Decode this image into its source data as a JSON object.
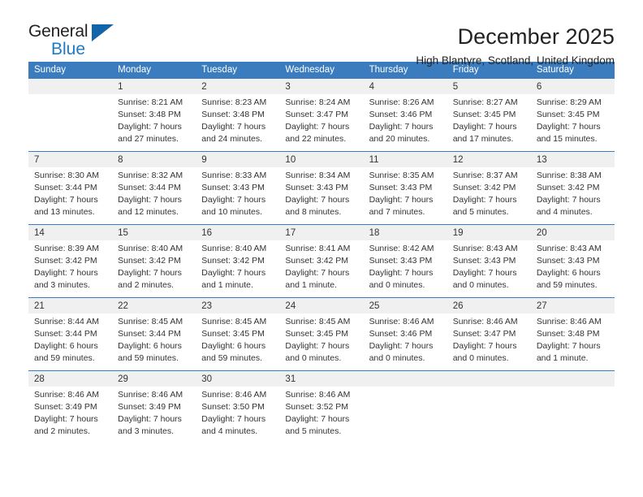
{
  "logo": {
    "primary_text": "General",
    "secondary_text": "Blue",
    "triangle_color": "#1165a8",
    "secondary_color": "#1f7ac4"
  },
  "header": {
    "title": "December 2025",
    "subtitle": "High Blantyre, Scotland, United Kingdom"
  },
  "colors": {
    "header_blue": "#3a7cbe",
    "daynum_bg": "#f0f0f0",
    "text": "#333333"
  },
  "weekdays": [
    "Sunday",
    "Monday",
    "Tuesday",
    "Wednesday",
    "Thursday",
    "Friday",
    "Saturday"
  ],
  "weeks": [
    [
      {
        "day": "",
        "sunrise": "",
        "sunset": "",
        "daylight": ""
      },
      {
        "day": "1",
        "sunrise": "Sunrise: 8:21 AM",
        "sunset": "Sunset: 3:48 PM",
        "daylight": "Daylight: 7 hours and 27 minutes."
      },
      {
        "day": "2",
        "sunrise": "Sunrise: 8:23 AM",
        "sunset": "Sunset: 3:48 PM",
        "daylight": "Daylight: 7 hours and 24 minutes."
      },
      {
        "day": "3",
        "sunrise": "Sunrise: 8:24 AM",
        "sunset": "Sunset: 3:47 PM",
        "daylight": "Daylight: 7 hours and 22 minutes."
      },
      {
        "day": "4",
        "sunrise": "Sunrise: 8:26 AM",
        "sunset": "Sunset: 3:46 PM",
        "daylight": "Daylight: 7 hours and 20 minutes."
      },
      {
        "day": "5",
        "sunrise": "Sunrise: 8:27 AM",
        "sunset": "Sunset: 3:45 PM",
        "daylight": "Daylight: 7 hours and 17 minutes."
      },
      {
        "day": "6",
        "sunrise": "Sunrise: 8:29 AM",
        "sunset": "Sunset: 3:45 PM",
        "daylight": "Daylight: 7 hours and 15 minutes."
      }
    ],
    [
      {
        "day": "7",
        "sunrise": "Sunrise: 8:30 AM",
        "sunset": "Sunset: 3:44 PM",
        "daylight": "Daylight: 7 hours and 13 minutes."
      },
      {
        "day": "8",
        "sunrise": "Sunrise: 8:32 AM",
        "sunset": "Sunset: 3:44 PM",
        "daylight": "Daylight: 7 hours and 12 minutes."
      },
      {
        "day": "9",
        "sunrise": "Sunrise: 8:33 AM",
        "sunset": "Sunset: 3:43 PM",
        "daylight": "Daylight: 7 hours and 10 minutes."
      },
      {
        "day": "10",
        "sunrise": "Sunrise: 8:34 AM",
        "sunset": "Sunset: 3:43 PM",
        "daylight": "Daylight: 7 hours and 8 minutes."
      },
      {
        "day": "11",
        "sunrise": "Sunrise: 8:35 AM",
        "sunset": "Sunset: 3:43 PM",
        "daylight": "Daylight: 7 hours and 7 minutes."
      },
      {
        "day": "12",
        "sunrise": "Sunrise: 8:37 AM",
        "sunset": "Sunset: 3:42 PM",
        "daylight": "Daylight: 7 hours and 5 minutes."
      },
      {
        "day": "13",
        "sunrise": "Sunrise: 8:38 AM",
        "sunset": "Sunset: 3:42 PM",
        "daylight": "Daylight: 7 hours and 4 minutes."
      }
    ],
    [
      {
        "day": "14",
        "sunrise": "Sunrise: 8:39 AM",
        "sunset": "Sunset: 3:42 PM",
        "daylight": "Daylight: 7 hours and 3 minutes."
      },
      {
        "day": "15",
        "sunrise": "Sunrise: 8:40 AM",
        "sunset": "Sunset: 3:42 PM",
        "daylight": "Daylight: 7 hours and 2 minutes."
      },
      {
        "day": "16",
        "sunrise": "Sunrise: 8:40 AM",
        "sunset": "Sunset: 3:42 PM",
        "daylight": "Daylight: 7 hours and 1 minute."
      },
      {
        "day": "17",
        "sunrise": "Sunrise: 8:41 AM",
        "sunset": "Sunset: 3:42 PM",
        "daylight": "Daylight: 7 hours and 1 minute."
      },
      {
        "day": "18",
        "sunrise": "Sunrise: 8:42 AM",
        "sunset": "Sunset: 3:43 PM",
        "daylight": "Daylight: 7 hours and 0 minutes."
      },
      {
        "day": "19",
        "sunrise": "Sunrise: 8:43 AM",
        "sunset": "Sunset: 3:43 PM",
        "daylight": "Daylight: 7 hours and 0 minutes."
      },
      {
        "day": "20",
        "sunrise": "Sunrise: 8:43 AM",
        "sunset": "Sunset: 3:43 PM",
        "daylight": "Daylight: 6 hours and 59 minutes."
      }
    ],
    [
      {
        "day": "21",
        "sunrise": "Sunrise: 8:44 AM",
        "sunset": "Sunset: 3:44 PM",
        "daylight": "Daylight: 6 hours and 59 minutes."
      },
      {
        "day": "22",
        "sunrise": "Sunrise: 8:45 AM",
        "sunset": "Sunset: 3:44 PM",
        "daylight": "Daylight: 6 hours and 59 minutes."
      },
      {
        "day": "23",
        "sunrise": "Sunrise: 8:45 AM",
        "sunset": "Sunset: 3:45 PM",
        "daylight": "Daylight: 6 hours and 59 minutes."
      },
      {
        "day": "24",
        "sunrise": "Sunrise: 8:45 AM",
        "sunset": "Sunset: 3:45 PM",
        "daylight": "Daylight: 7 hours and 0 minutes."
      },
      {
        "day": "25",
        "sunrise": "Sunrise: 8:46 AM",
        "sunset": "Sunset: 3:46 PM",
        "daylight": "Daylight: 7 hours and 0 minutes."
      },
      {
        "day": "26",
        "sunrise": "Sunrise: 8:46 AM",
        "sunset": "Sunset: 3:47 PM",
        "daylight": "Daylight: 7 hours and 0 minutes."
      },
      {
        "day": "27",
        "sunrise": "Sunrise: 8:46 AM",
        "sunset": "Sunset: 3:48 PM",
        "daylight": "Daylight: 7 hours and 1 minute."
      }
    ],
    [
      {
        "day": "28",
        "sunrise": "Sunrise: 8:46 AM",
        "sunset": "Sunset: 3:49 PM",
        "daylight": "Daylight: 7 hours and 2 minutes."
      },
      {
        "day": "29",
        "sunrise": "Sunrise: 8:46 AM",
        "sunset": "Sunset: 3:49 PM",
        "daylight": "Daylight: 7 hours and 3 minutes."
      },
      {
        "day": "30",
        "sunrise": "Sunrise: 8:46 AM",
        "sunset": "Sunset: 3:50 PM",
        "daylight": "Daylight: 7 hours and 4 minutes."
      },
      {
        "day": "31",
        "sunrise": "Sunrise: 8:46 AM",
        "sunset": "Sunset: 3:52 PM",
        "daylight": "Daylight: 7 hours and 5 minutes."
      },
      {
        "day": "",
        "sunrise": "",
        "sunset": "",
        "daylight": ""
      },
      {
        "day": "",
        "sunrise": "",
        "sunset": "",
        "daylight": ""
      },
      {
        "day": "",
        "sunrise": "",
        "sunset": "",
        "daylight": ""
      }
    ]
  ]
}
